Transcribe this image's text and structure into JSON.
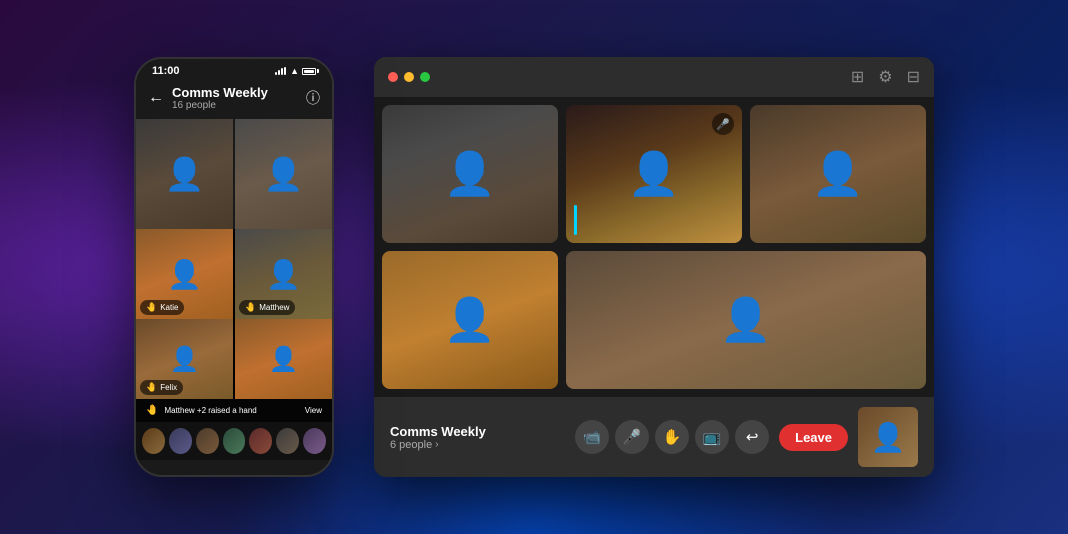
{
  "background": {
    "gradient": "purple-blue"
  },
  "phone": {
    "status_bar": {
      "time": "11:00"
    },
    "header": {
      "back_label": "←",
      "title": "Comms Weekly",
      "subtitle": "16 people",
      "info_icon": "ⓘ"
    },
    "participants": [
      {
        "name": "",
        "face_class": "phone-face-1"
      },
      {
        "name": "",
        "face_class": "phone-face-2"
      },
      {
        "name": "Katie",
        "face_class": "phone-face-3",
        "hand": "🤚"
      },
      {
        "name": "Matthew",
        "face_class": "phone-face-4",
        "hand": "🤚"
      },
      {
        "name": "Felix",
        "face_class": "phone-face-5",
        "hand": "🤚"
      },
      {
        "name": "",
        "face_class": "phone-face-6"
      }
    ],
    "raised_hand_bar": {
      "text": "Matthew +2 raised a hand",
      "hand_icon": "🤚",
      "view_label": "View"
    },
    "thumbnails_count": 7
  },
  "desktop": {
    "window": {
      "traffic_lights": [
        "red",
        "yellow",
        "green"
      ]
    },
    "controls": {
      "apps_icon": "⊞",
      "settings_icon": "⚙",
      "layout_icon": "⊟"
    },
    "participants": [
      {
        "face_class": "dv-face-1",
        "has_mic": false,
        "has_indicator": false
      },
      {
        "face_class": "dv-face-2",
        "has_mic": true,
        "has_indicator": true
      },
      {
        "face_class": "dv-face-3",
        "has_mic": false,
        "has_indicator": false
      },
      {
        "face_class": "dv-face-4",
        "has_mic": false,
        "has_indicator": false
      },
      {
        "face_class": "dv-face-5",
        "has_mic": false,
        "has_indicator": false
      }
    ],
    "bottom_bar": {
      "meeting_name": "Comms Weekly",
      "meeting_count": "6 people",
      "chevron": ">",
      "controls": [
        {
          "icon": "📹",
          "label": "camera"
        },
        {
          "icon": "🎤",
          "label": "mic"
        },
        {
          "icon": "✋",
          "label": "hand"
        },
        {
          "icon": "📺",
          "label": "screen"
        },
        {
          "icon": "↩",
          "label": "more"
        }
      ],
      "leave_label": "Leave"
    }
  }
}
